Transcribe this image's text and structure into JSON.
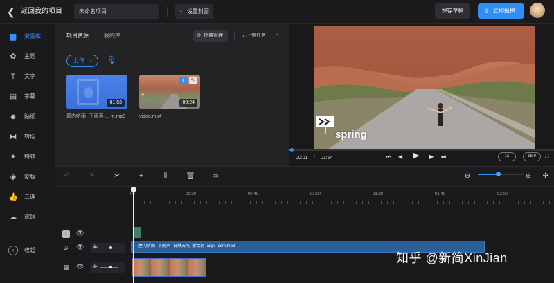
{
  "header": {
    "back_label": "返回我的项目",
    "project_name": "未命名项目",
    "cover_label": "设置封面",
    "save_draft_label": "保存草稿",
    "publish_label": "立即投稿"
  },
  "sidebar": {
    "items": [
      {
        "label": "资源库",
        "icon": "folder-icon",
        "active": true
      },
      {
        "label": "主题",
        "icon": "theme-icon"
      },
      {
        "label": "文字",
        "icon": "text-icon"
      },
      {
        "label": "字幕",
        "icon": "subtitle-icon"
      },
      {
        "label": "贴纸",
        "icon": "sticker-icon"
      },
      {
        "label": "转场",
        "icon": "transition-icon"
      },
      {
        "label": "特效",
        "icon": "effects-icon"
      },
      {
        "label": "蒙版",
        "icon": "mask-icon"
      },
      {
        "label": "三连",
        "icon": "thumbs-up-icon"
      },
      {
        "label": "滤镜",
        "icon": "filter-icon"
      }
    ],
    "collapse_label": "收起"
  },
  "panel": {
    "tabs": [
      {
        "label": "项目资源",
        "active": true
      },
      {
        "label": "我的库"
      }
    ],
    "batch_label": "批量管理",
    "no_task_label": "无上传任务",
    "upload_label": "上传",
    "assets": [
      {
        "name": "屋内听雨--下雨声-... m.mp3",
        "duration": "01:53",
        "type": "audio"
      },
      {
        "name": "video.mp4",
        "duration": "00:24",
        "type": "video"
      }
    ]
  },
  "preview": {
    "overlay_text": "spring",
    "current_time": "00:01",
    "separator": "/",
    "total_time": "01:54",
    "progress": 0.01,
    "speed_label": "1x",
    "ratio_label": "16:9"
  },
  "timeline": {
    "ruler": [
      "00",
      "00:20",
      "00:40",
      "01:00",
      "01:20",
      "01:40",
      "02:00"
    ],
    "audio_clip_name": "屋内听雨--下雨声--自然天气_爱给网_aigei_com.mp3",
    "zoom_level": 0.45
  },
  "watermark": "知乎 @新简XinJian",
  "colors": {
    "accent": "#2f8ff5",
    "background": "#151517",
    "panel": "#232326"
  }
}
